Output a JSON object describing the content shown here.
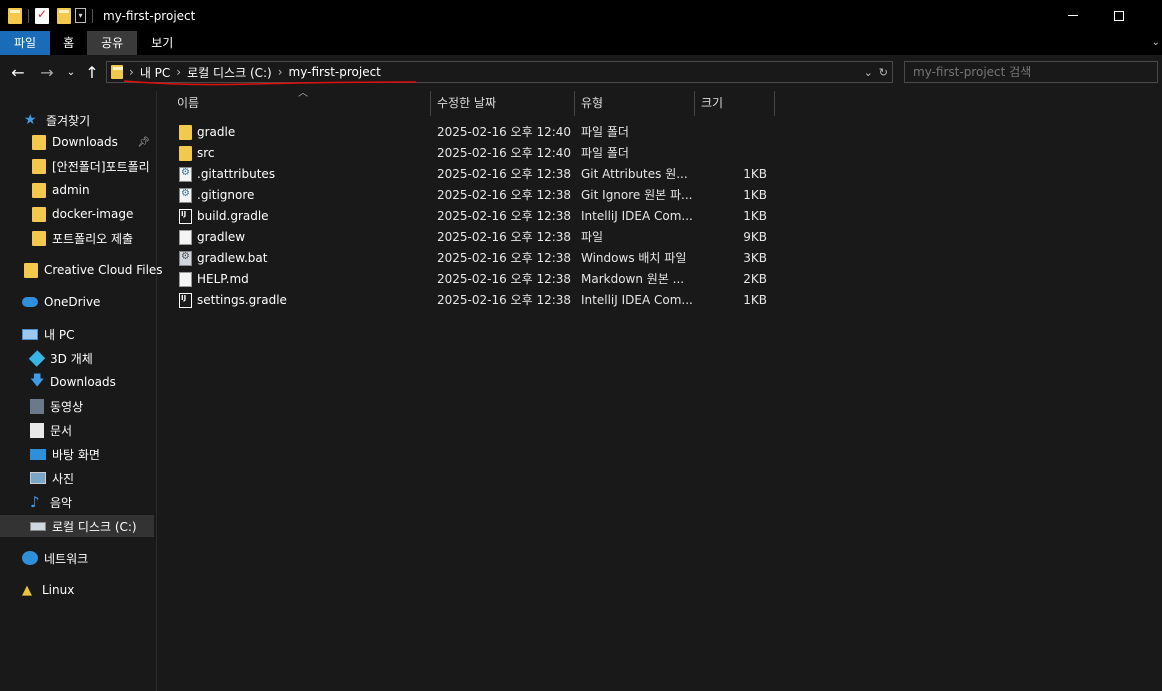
{
  "window": {
    "title": "my-first-project"
  },
  "ribbon": {
    "tabs": [
      "파일",
      "홈",
      "공유",
      "보기"
    ]
  },
  "nav": {
    "breadcrumbs": [
      "내 PC",
      "로컬 디스크 (C:)",
      "my-first-project"
    ],
    "search_placeholder": "my-first-project 검색"
  },
  "sidebar": {
    "quick_access": {
      "label": "즐겨찾기",
      "items": [
        {
          "label": "Downloads",
          "pinned": true
        },
        {
          "label": "[안전폴더]포트폴리"
        },
        {
          "label": "admin"
        },
        {
          "label": "docker-image"
        },
        {
          "label": "포트폴리오 제출"
        }
      ]
    },
    "creative_cloud": "Creative Cloud Files",
    "onedrive": "OneDrive",
    "this_pc": {
      "label": "내 PC",
      "items": [
        {
          "label": "3D 개체"
        },
        {
          "label": "Downloads"
        },
        {
          "label": "동영상"
        },
        {
          "label": "문서"
        },
        {
          "label": "바탕 화면"
        },
        {
          "label": "사진"
        },
        {
          "label": "음악"
        },
        {
          "label": "로컬 디스크 (C:)",
          "selected": true
        }
      ]
    },
    "network": "네트워크",
    "linux": "Linux"
  },
  "files": {
    "columns": [
      "이름",
      "수정한 날짜",
      "유형",
      "크기"
    ],
    "rows": [
      {
        "name": "gradle",
        "date": "2025-02-16 오후 12:40",
        "type": "파일 폴더",
        "size": "",
        "icon": "folder-icon"
      },
      {
        "name": "src",
        "date": "2025-02-16 오후 12:40",
        "type": "파일 폴더",
        "size": "",
        "icon": "folder-icon"
      },
      {
        "name": ".gitattributes",
        "date": "2025-02-16 오후 12:38",
        "type": "Git Attributes 원...",
        "size": "1KB",
        "icon": "git-file-icon"
      },
      {
        "name": ".gitignore",
        "date": "2025-02-16 오후 12:38",
        "type": "Git Ignore 원본 파...",
        "size": "1KB",
        "icon": "git-file-icon"
      },
      {
        "name": "build.gradle",
        "date": "2025-02-16 오후 12:38",
        "type": "IntelliJ IDEA Com...",
        "size": "1KB",
        "icon": "intellij-file-icon"
      },
      {
        "name": "gradlew",
        "date": "2025-02-16 오후 12:38",
        "type": "파일",
        "size": "9KB",
        "icon": "blank-file-icon"
      },
      {
        "name": "gradlew.bat",
        "date": "2025-02-16 오후 12:38",
        "type": "Windows 배치 파일",
        "size": "3KB",
        "icon": "batch-file-icon"
      },
      {
        "name": "HELP.md",
        "date": "2025-02-16 오후 12:38",
        "type": "Markdown 원본 ...",
        "size": "2KB",
        "icon": "blank-file-icon"
      },
      {
        "name": "settings.gradle",
        "date": "2025-02-16 오후 12:38",
        "type": "IntelliJ IDEA Com...",
        "size": "1KB",
        "icon": "intellij-file-icon"
      }
    ]
  },
  "colors": {
    "accent": "#1a6bb8",
    "folder": "#f2c94c",
    "annotation_underline": "#e01010"
  }
}
